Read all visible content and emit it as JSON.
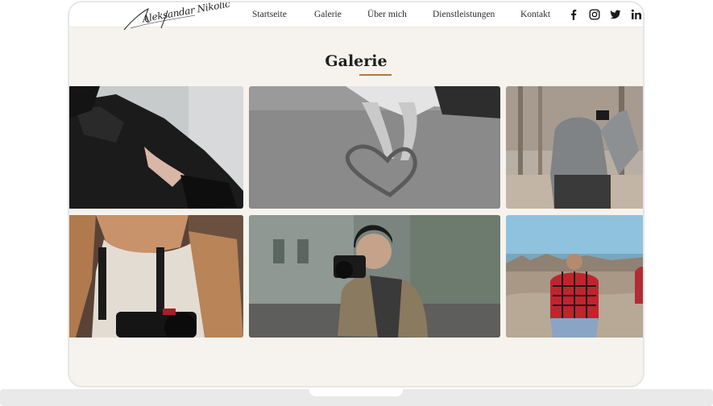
{
  "header": {
    "logo_text": "Aleksandar Nikolic",
    "nav": [
      {
        "label": "Startseite"
      },
      {
        "label": "Galerie"
      },
      {
        "label": "Über mich"
      },
      {
        "label": "Dienstleistungen"
      },
      {
        "label": "Kontakt"
      }
    ],
    "social": [
      "facebook-icon",
      "instagram-icon",
      "twitter-icon",
      "linkedin-icon"
    ]
  },
  "main": {
    "title": "Galerie",
    "accent_color": "#b5773c",
    "photos": [
      {
        "subject": "woman-in-leather-jacket"
      },
      {
        "subject": "heart-drawn-in-sand"
      },
      {
        "subject": "child-in-grey-hood-with-camera"
      },
      {
        "subject": "woman-holding-camera"
      },
      {
        "subject": "man-photographing-street"
      },
      {
        "subject": "man-in-red-plaid-city-view"
      }
    ]
  },
  "colors": {
    "page_background": "#f6f3ee",
    "header_background": "#ffffff"
  }
}
